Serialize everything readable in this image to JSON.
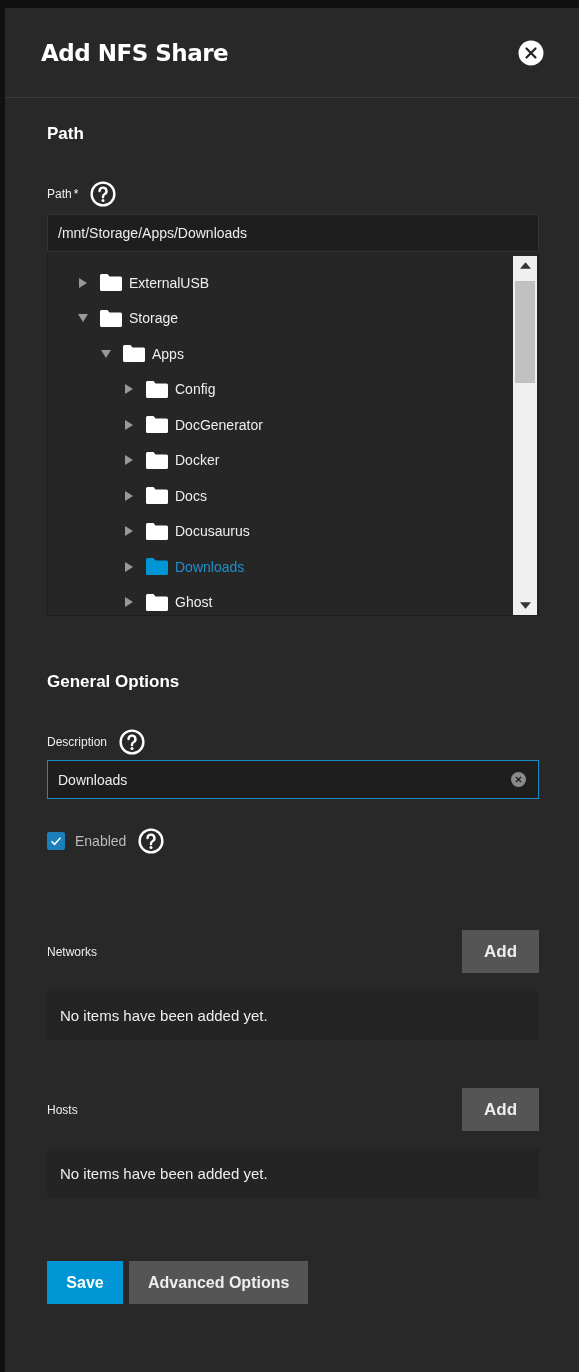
{
  "title": "Add NFS Share",
  "path_section": {
    "heading": "Path",
    "label": "Path",
    "required_mark": "*",
    "value": "/mnt/Storage/Apps/Downloads"
  },
  "tree": [
    {
      "label": "ExternalUSB",
      "expanded": false,
      "selected": false
    },
    {
      "label": "Storage",
      "expanded": true,
      "selected": false,
      "children": [
        {
          "label": "Apps",
          "expanded": true,
          "selected": false,
          "children": [
            {
              "label": "Config",
              "expanded": false,
              "selected": false
            },
            {
              "label": "DocGenerator",
              "expanded": false,
              "selected": false
            },
            {
              "label": "Docker",
              "expanded": false,
              "selected": false
            },
            {
              "label": "Docs",
              "expanded": false,
              "selected": false
            },
            {
              "label": "Docusaurus",
              "expanded": false,
              "selected": false
            },
            {
              "label": "Downloads",
              "expanded": false,
              "selected": true
            },
            {
              "label": "Ghost",
              "expanded": false,
              "selected": false
            }
          ]
        }
      ]
    }
  ],
  "general": {
    "heading": "General Options",
    "description_label": "Description",
    "description_value": "Downloads",
    "enabled_label": "Enabled",
    "enabled": true
  },
  "lists": [
    {
      "label": "Networks",
      "add_button": "Add",
      "empty_text": "No items have been added yet."
    },
    {
      "label": "Hosts",
      "add_button": "Add",
      "empty_text": "No items have been added yet."
    }
  ],
  "buttons": [
    {
      "label": "Save",
      "kind": "primary"
    },
    {
      "label": "Advanced Options",
      "kind": "secondary"
    }
  ]
}
